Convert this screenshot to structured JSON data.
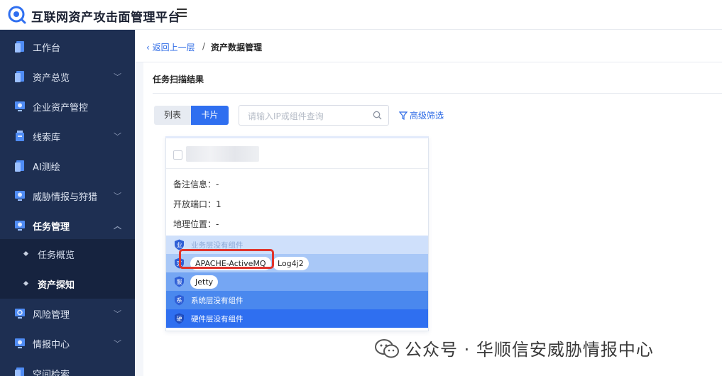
{
  "app": {
    "title": "互联网资产攻击面管理平台"
  },
  "sidebar": {
    "items": [
      {
        "label": "工作台",
        "icon": "doc-icon",
        "chevron": ""
      },
      {
        "label": "资产总览",
        "icon": "doc-icon",
        "chevron": "﹀"
      },
      {
        "label": "企业资产管控",
        "icon": "monitor-icon",
        "chevron": ""
      },
      {
        "label": "线索库",
        "icon": "stack-icon",
        "chevron": "﹀"
      },
      {
        "label": "AI测绘",
        "icon": "doc-icon",
        "chevron": ""
      },
      {
        "label": "威胁情报与狩猎",
        "icon": "monitor-icon",
        "chevron": "﹀"
      },
      {
        "label": "任务管理",
        "icon": "monitor-icon",
        "chevron": "︿"
      },
      {
        "label": "风险管理",
        "icon": "gear-icon",
        "chevron": "﹀"
      },
      {
        "label": "情报中心",
        "icon": "monitor-icon",
        "chevron": "﹀"
      },
      {
        "label": "空间检索",
        "icon": "doc-icon",
        "chevron": ""
      }
    ],
    "sub_items": [
      {
        "label": "任务概览"
      },
      {
        "label": "资产探知"
      }
    ]
  },
  "breadcrumb": {
    "back": "返回上一层",
    "separator": "/",
    "current": "资产数据管理"
  },
  "panel": {
    "title": "任务扫描结果",
    "view_list": "列表",
    "view_card": "卡片",
    "search_placeholder": "请输入IP或组件查询",
    "advanced_filter": "高级筛选"
  },
  "card": {
    "remark_label": "备注信息：",
    "remark_value": "-",
    "ports_label": "开放端口：",
    "ports_value": "1",
    "geo_label": "地理位置：",
    "geo_value": "-",
    "layers": [
      {
        "badge": "业",
        "text": "业务层没有组件",
        "bg": "#cfe0fb",
        "color": "#8aa7d6"
      },
      {
        "badge": "支",
        "text": "",
        "bg": "#a9c8f7",
        "color": "#ffffff",
        "chips": [
          "APACHE-ActiveMQ",
          "Log4j2"
        ]
      },
      {
        "badge": "服",
        "text": "",
        "bg": "#75a6f3",
        "color": "#ffffff",
        "chips": [
          "Jetty"
        ]
      },
      {
        "badge": "系",
        "text": "系统层没有组件",
        "bg": "#4a88ee",
        "color": "#ffffff"
      },
      {
        "badge": "硬",
        "text": "硬件层没有组件",
        "bg": "#2f6ff0",
        "color": "#ffffff"
      }
    ]
  },
  "watermark": {
    "text": "公众号 · 华顺信安威胁情报中心"
  },
  "colors": {
    "primary": "#2f6ff0",
    "sidebar": "#1e2f52",
    "highlight": "#e0342c"
  }
}
